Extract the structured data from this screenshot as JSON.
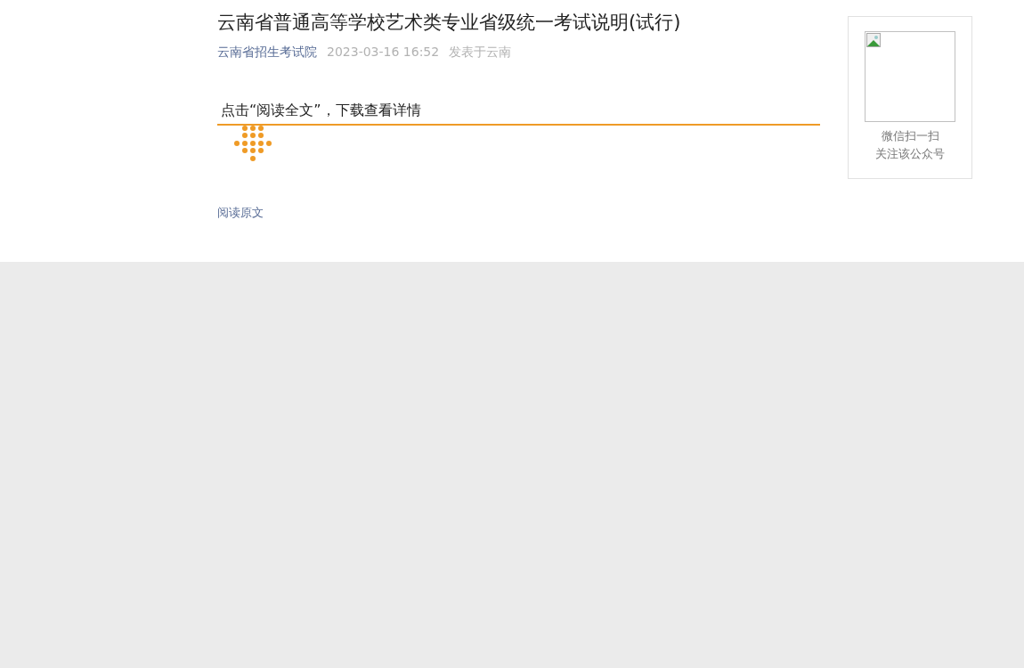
{
  "article": {
    "title": "云南省普通高等学校艺术类专业省级统一考试说明(试行)",
    "meta": {
      "account": "云南省招生考试院",
      "time": "2023-03-16 16:52",
      "location": "发表于云南"
    },
    "body_text": "点击“阅读全文”，下载查看详情",
    "read_original": "阅读原文"
  },
  "qr_panel": {
    "caption_lines": [
      "微信扫一扫",
      "关注该公众号"
    ]
  }
}
